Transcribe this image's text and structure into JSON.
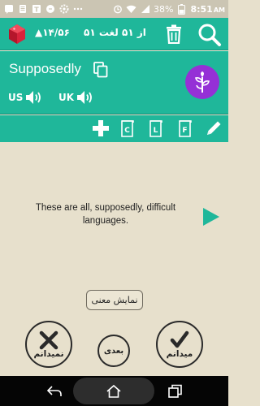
{
  "status_bar": {
    "battery": "38%",
    "time": "8:51",
    "ampm": "AM"
  },
  "header": {
    "progress": "▲۱۴/۵۶",
    "word_counter": "۵۱ از ۵۱ لغت"
  },
  "word": {
    "text": "Supposedly",
    "pronunciations": [
      {
        "label": "US"
      },
      {
        "label": "UK"
      }
    ]
  },
  "toolbar": {
    "books": [
      "C",
      "L",
      "F"
    ]
  },
  "content": {
    "example": "These are all, supposedly, difficult languages.",
    "show_meaning_label": "نمایش معنی",
    "dont_know_label": "نمیدانم",
    "next_label": "بعدی",
    "know_label": "میدانم"
  },
  "colors": {
    "primary": "#1fb79a",
    "background": "#e7e0cc",
    "avatar": "#9530d6",
    "gem": "#d9233b"
  }
}
